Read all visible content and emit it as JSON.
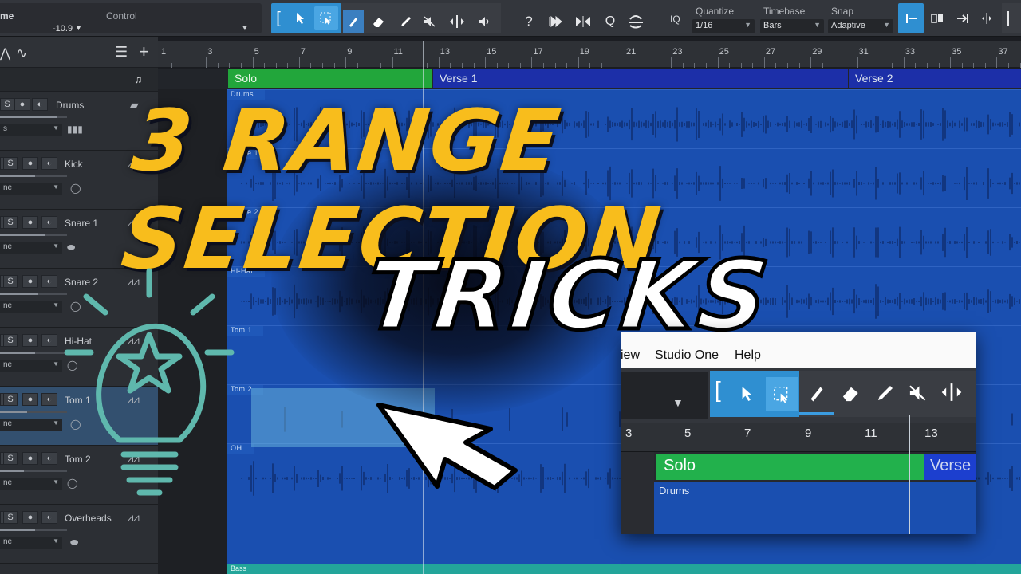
{
  "toolbar": {
    "left_label_time": "me",
    "left_value": "-10.9",
    "control_label": "Control",
    "quantize_label": "Quantize",
    "quantize_value": "1/16",
    "timebase_label": "Timebase",
    "timebase_value": "Bars",
    "snap_label": "Snap",
    "snap_value": "Adaptive",
    "iq_label": "IQ"
  },
  "ruler": {
    "bars": [
      "1",
      "3",
      "5",
      "7",
      "9",
      "11",
      "13",
      "15",
      "17",
      "19",
      "21",
      "23",
      "25",
      "27",
      "29",
      "31",
      "33",
      "35",
      "37"
    ]
  },
  "markers": [
    {
      "label": "Solo",
      "color": "#22a63b"
    },
    {
      "label": "Verse 1",
      "color": "#1c2fa8"
    },
    {
      "label": "Verse 2",
      "color": "#1c2fa8"
    }
  ],
  "tracks": [
    {
      "name": "Drums",
      "drop": "s"
    },
    {
      "name": "Kick",
      "drop": "ne"
    },
    {
      "name": "Snare 1",
      "drop": "ne"
    },
    {
      "name": "Snare 2",
      "drop": "ne"
    },
    {
      "name": "Hi-Hat",
      "drop": "ne"
    },
    {
      "name": "Tom 1",
      "drop": "ne"
    },
    {
      "name": "Tom 2",
      "drop": "ne"
    },
    {
      "name": "Overheads",
      "drop": "ne"
    }
  ],
  "lanes": [
    "Drums",
    "Snare 1",
    "Snare 2",
    "Hi-Hat",
    "Tom 1",
    "Tom 2",
    "OH",
    "Bass"
  ],
  "headline": {
    "main": "3 RANGE SELECTION",
    "sub": "TRICKS",
    "color": "#f8bd1c"
  },
  "inset": {
    "menu": [
      "iew",
      "Studio One",
      "Help"
    ],
    "ruler": [
      "3",
      "5",
      "7",
      "9",
      "11",
      "13"
    ],
    "solo": "Solo",
    "verse": "Verse",
    "lane": "Drums"
  }
}
